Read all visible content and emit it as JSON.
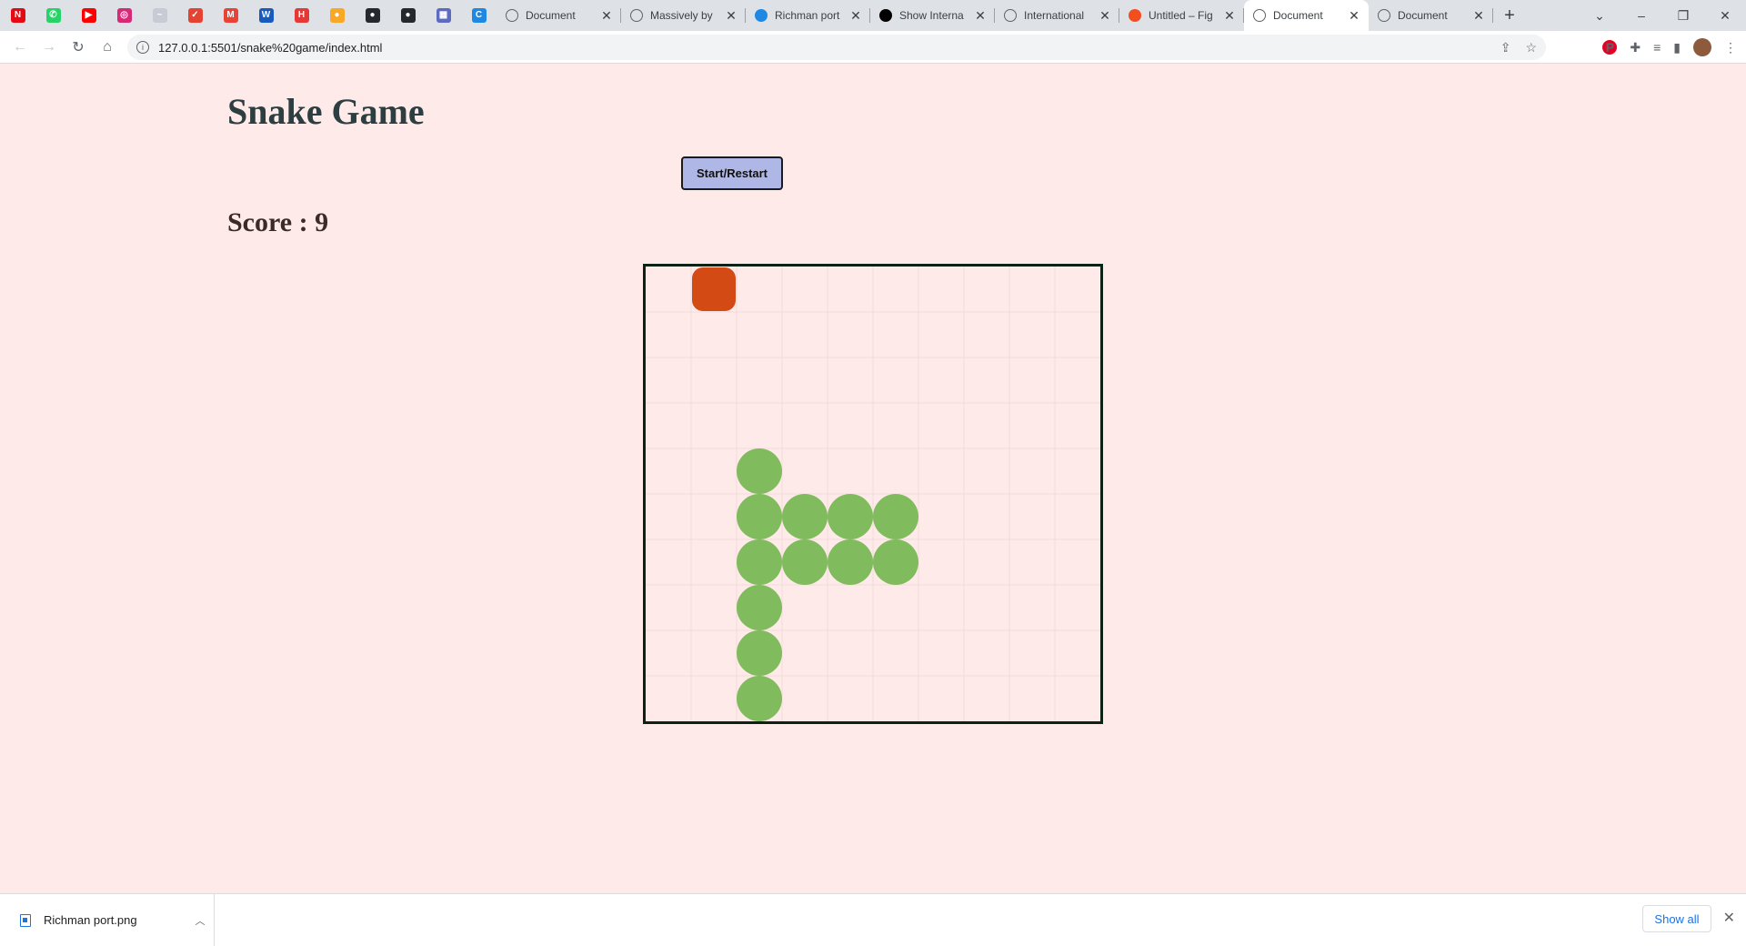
{
  "browser": {
    "pinned_tabs": [
      {
        "icon": "netflix-icon",
        "glyph": "N",
        "color": "#e50914"
      },
      {
        "icon": "whatsapp-icon",
        "glyph": "✆",
        "color": "#25d366"
      },
      {
        "icon": "youtube-icon",
        "glyph": "▶",
        "color": "#ff0000"
      },
      {
        "icon": "instagram-icon",
        "glyph": "◎",
        "color": "#d62976"
      },
      {
        "icon": "generic-page-icon",
        "glyph": "~",
        "color": "#c9cbd4"
      },
      {
        "icon": "todo-icon",
        "glyph": "✓",
        "color": "#e44332"
      },
      {
        "icon": "gmail-icon",
        "glyph": "M",
        "color": "#ea4335"
      },
      {
        "icon": "word-icon",
        "glyph": "W",
        "color": "#185abd"
      },
      {
        "icon": "app-icon",
        "glyph": "H",
        "color": "#e53935"
      },
      {
        "icon": "badge-icon",
        "glyph": "●",
        "color": "#f9a825"
      },
      {
        "icon": "github-icon",
        "glyph": "●",
        "color": "#24292f"
      },
      {
        "icon": "github-icon",
        "glyph": "●",
        "color": "#24292f"
      },
      {
        "icon": "grid-app-icon",
        "glyph": "▦",
        "color": "#5c6bc0"
      },
      {
        "icon": "edge-icon",
        "glyph": "C",
        "color": "#1e88e5"
      }
    ],
    "tabs": [
      {
        "title": "Document",
        "favicon": "globe-icon",
        "active": false
      },
      {
        "title": "Massively by",
        "favicon": "globe-icon",
        "active": false
      },
      {
        "title": "Richman port",
        "favicon": "app-icon",
        "active": false
      },
      {
        "title": "Show Interna",
        "favicon": "circle-icon",
        "active": false
      },
      {
        "title": "International",
        "favicon": "globe-icon",
        "active": false
      },
      {
        "title": "Untitled – Fig",
        "favicon": "figma-icon",
        "active": false
      },
      {
        "title": "Document",
        "favicon": "globe-icon",
        "active": true
      },
      {
        "title": "Document",
        "favicon": "globe-icon",
        "active": false
      }
    ],
    "url": "127.0.0.1:5501/snake%20game/index.html"
  },
  "page": {
    "title": "Snake Game",
    "start_button_label": "Start/Restart",
    "score_label": "Score : 9"
  },
  "game": {
    "grid_size": 10,
    "colors": {
      "background": "#ffeaea",
      "grid_line": "#f0dada",
      "snake": "#80bb5d",
      "food": "#d34a14",
      "border": "#0d2216"
    },
    "food": {
      "col": 1,
      "row": 0
    },
    "snake": [
      {
        "col": 2,
        "row": 4
      },
      {
        "col": 2,
        "row": 5
      },
      {
        "col": 3,
        "row": 5
      },
      {
        "col": 4,
        "row": 5
      },
      {
        "col": 5,
        "row": 5
      },
      {
        "col": 2,
        "row": 6
      },
      {
        "col": 3,
        "row": 6
      },
      {
        "col": 4,
        "row": 6
      },
      {
        "col": 5,
        "row": 6
      },
      {
        "col": 2,
        "row": 7
      },
      {
        "col": 2,
        "row": 8
      },
      {
        "col": 2,
        "row": 9
      }
    ]
  },
  "downloads": {
    "file_name": "Richman port.png",
    "show_all_label": "Show all"
  }
}
